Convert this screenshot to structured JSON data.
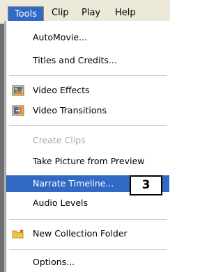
{
  "menubar": {
    "tools_label": "Tools",
    "clip_label": "Clip",
    "play_label": "Play",
    "help_label": "Help"
  },
  "tools_menu": {
    "items": [
      {
        "label": "AutoMovie..."
      },
      {
        "label": "Titles and Credits..."
      },
      {
        "label": "Video Effects",
        "icon": "video-effects-icon"
      },
      {
        "label": "Video Transitions",
        "icon": "video-transitions-icon"
      },
      {
        "label": "Create Clips",
        "state": "disabled"
      },
      {
        "label": "Take Picture from Preview"
      },
      {
        "label": "Narrate Timeline...",
        "state": "highlighted"
      },
      {
        "label": "Audio Levels"
      },
      {
        "label": "New Collection Folder",
        "icon": "new-folder-icon"
      },
      {
        "label": "Options..."
      }
    ]
  },
  "callout": {
    "number": "3"
  },
  "colors": {
    "highlight": "#316ac5",
    "menubar_bg": "#ece9d8",
    "disabled_text": "#a7a6aa"
  }
}
